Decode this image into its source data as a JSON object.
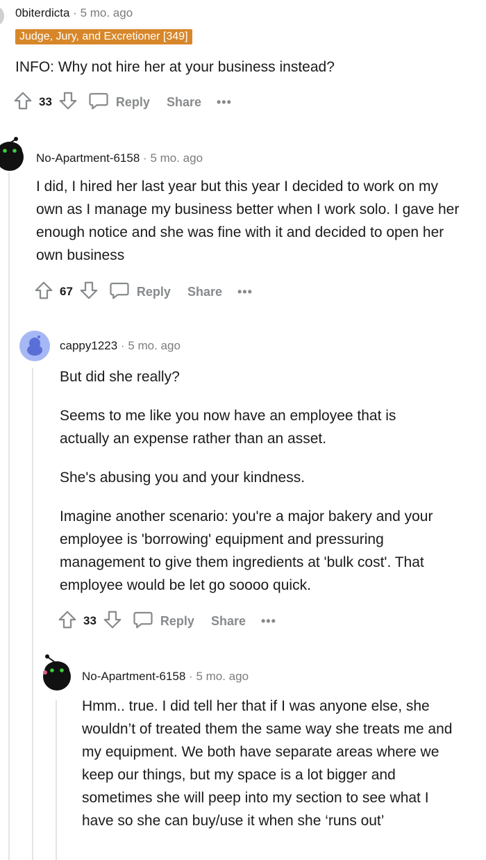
{
  "comments": [
    {
      "username": "0biterdicta",
      "time": "5 mo. ago",
      "flair": "Judge, Jury, and Excretioner [349]",
      "body": [
        "INFO: Why not hire her at your business instead?"
      ],
      "votes": "33",
      "reply": "Reply",
      "share": "Share",
      "more": "•••"
    },
    {
      "username": "No-Apartment-6158",
      "time": "5 mo. ago",
      "body": [
        "I did, I hired her last year but this year I decided to work on my own as I manage my business better when I work solo. I gave her enough notice and she was fine with it and decided to open her own business"
      ],
      "votes": "67",
      "reply": "Reply",
      "share": "Share",
      "more": "•••"
    },
    {
      "username": "cappy1223",
      "time": "5 mo. ago",
      "body": [
        "But did she really?",
        "Seems to me like you now have an employee that is actually an expense rather than an asset.",
        "She's abusing you and your kindness.",
        "Imagine another scenario: you're a major bakery and your employee is 'borrowing' equipment and pressuring management to give them ingredients at 'bulk cost'. That employee would be let go soooo quick."
      ],
      "votes": "33",
      "reply": "Reply",
      "share": "Share",
      "more": "•••"
    },
    {
      "username": "No-Apartment-6158",
      "time": "5 mo. ago",
      "body": [
        "Hmm.. true. I did tell her that if I was anyone else, she wouldn’t of treated them the same way she treats me and my equipment. We both have separate areas where we keep our things, but my space is a lot bigger and sometimes she will peep into my section to see what I have so she can buy/use it when she ‘runs out’"
      ]
    }
  ],
  "colors": {
    "flair_bg": "#d7872a",
    "avatar_snoo": "#111111",
    "avatar_blue": "#a6b7f5"
  }
}
